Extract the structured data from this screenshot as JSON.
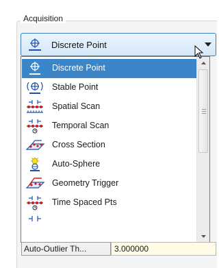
{
  "group": {
    "title": "Acquisition"
  },
  "combo": {
    "selected_label": "Discrete Point",
    "selected_icon": "discrete-point-icon"
  },
  "dropdown": {
    "items": [
      {
        "label": "Discrete Point",
        "icon": "discrete-point-icon",
        "selected": true
      },
      {
        "label": "Stable Point",
        "icon": "stable-point-icon",
        "selected": false
      },
      {
        "label": "Spatial Scan",
        "icon": "spatial-scan-icon",
        "selected": false
      },
      {
        "label": "Temporal Scan",
        "icon": "temporal-scan-icon",
        "selected": false
      },
      {
        "label": "Cross Section",
        "icon": "cross-section-icon",
        "selected": false
      },
      {
        "label": "Auto-Sphere",
        "icon": "auto-sphere-icon",
        "selected": false
      },
      {
        "label": "Geometry Trigger",
        "icon": "geometry-trigger-icon",
        "selected": false
      },
      {
        "label": "Time Spaced Pts",
        "icon": "time-spaced-pts-icon",
        "selected": false
      }
    ]
  },
  "property": {
    "label": "Auto-Outlier Th...",
    "value": "3.000000"
  },
  "colors": {
    "selection": "#3a86c8",
    "combo_border": "#3b7fc9",
    "value_background": "#fffbe6"
  }
}
